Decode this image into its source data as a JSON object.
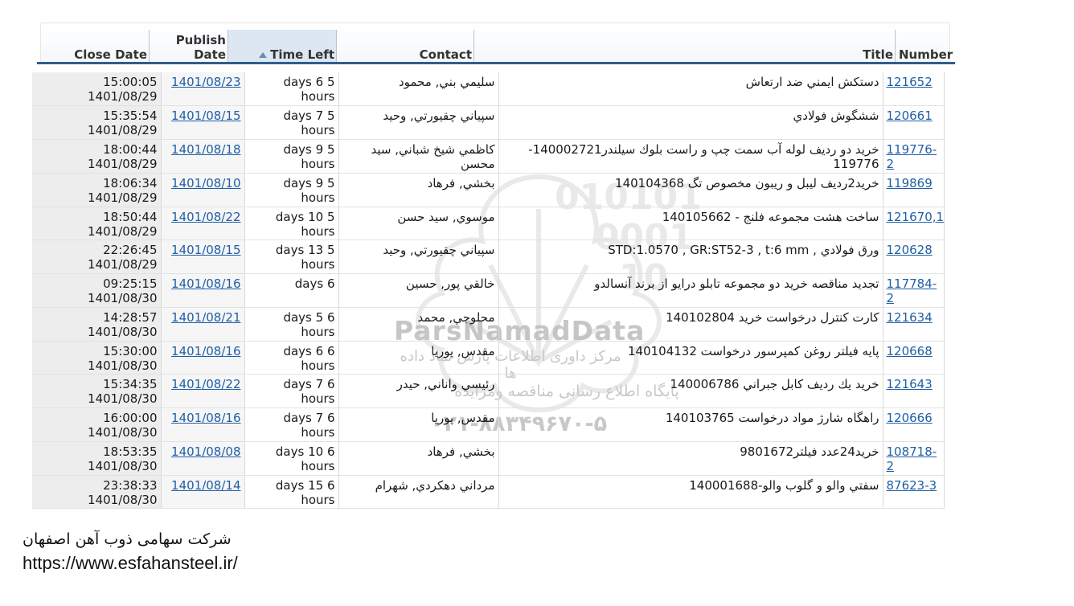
{
  "headers": {
    "close_date": "Close Date",
    "publish_date_line1": "Publish",
    "publish_date_line2": "Date",
    "time_left": "Time Left",
    "contact": "Contact",
    "title": "Title",
    "number": "Number"
  },
  "rows": [
    {
      "close": "15:00:05 1401/08/29",
      "publish": "1401/08/23",
      "time_left": "5 days 6 hours",
      "contact": "سليمي بني, محمود",
      "title": "دستكش ايمني ضد ارتعاش",
      "number": "121652"
    },
    {
      "close": "15:35:54 1401/08/29",
      "publish": "1401/08/15",
      "time_left": "5 days 7 hours",
      "contact": "سپياني چقيورتي, وحيد",
      "title": "ششگوش فولادي",
      "number": "120661"
    },
    {
      "close": "18:00:44 1401/08/29",
      "publish": "1401/08/18",
      "time_left": "5 days 9 hours",
      "contact": "كاظمي شيخ شباني, سيد محسن",
      "title": "خريد دو رديف لوله آب سمت چپ و راست بلوك سيلندر140002721-119776",
      "number": "119776-2"
    },
    {
      "close": "18:06:34 1401/08/29",
      "publish": "1401/08/10",
      "time_left": "5 days 9 hours",
      "contact": "بخشي, فرهاد",
      "title": "خريد2رديف ليبل و ريبون مخصوص تگ 140104368",
      "number": "119869"
    },
    {
      "close": "18:50:44 1401/08/29",
      "publish": "1401/08/22",
      "time_left": "5 days 10 hours",
      "contact": "موسوي, سيد حسن",
      "title": "ساخت هشت مجموعه فلنج - 140105662",
      "number": "121670,1"
    },
    {
      "close": "22:26:45 1401/08/29",
      "publish": "1401/08/15",
      "time_left": "5 days 13 hours",
      "contact": "سپياني چقيورتي, وحيد",
      "title": "ورق فولادي , STD:1.0570 , GR:ST52-3 , t:6 mm",
      "number": "120628"
    },
    {
      "close": "09:25:15 1401/08/30",
      "publish": "1401/08/16",
      "time_left": "6 days",
      "contact": "خالقي پور, حسين",
      "title": "تجديد مناقصه خريد دو مجموعه تابلو درايو از برند آنسالدو",
      "number": "117784-2"
    },
    {
      "close": "14:28:57 1401/08/30",
      "publish": "1401/08/21",
      "time_left": "6 days 5 hours",
      "contact": "محلوجي, محمد",
      "title": "كارت كنترل درخواست خريد 140102804",
      "number": "121634"
    },
    {
      "close": "15:30:00 1401/08/30",
      "publish": "1401/08/16",
      "time_left": "6 days 6 hours",
      "contact": "مقدس, پوريا",
      "title": "پايه فيلتر روغن كمپرسور درخواست 140104132",
      "number": "120668"
    },
    {
      "close": "15:34:35 1401/08/30",
      "publish": "1401/08/22",
      "time_left": "6 days 7 hours",
      "contact": "رئيسي واناني, حيدر",
      "title": "خريد يك رديف كابل جبراني 140006786",
      "number": "121643"
    },
    {
      "close": "16:00:00 1401/08/30",
      "publish": "1401/08/16",
      "time_left": "6 days 7 hours",
      "contact": "مقدس, پوريا",
      "title": "راهگاه شارژ مواد درخواست 140103765",
      "number": "120666"
    },
    {
      "close": "18:53:35 1401/08/30",
      "publish": "1401/08/08",
      "time_left": "6 days 10 hours",
      "contact": "بخشي, فرهاد",
      "title": "خريد24عدد فيلتر9801672",
      "number": "108718-2"
    },
    {
      "close": "23:38:33 1401/08/30",
      "publish": "1401/08/14",
      "time_left": "6 days 15 hours",
      "contact": "مرداني دهكردي, شهرام",
      "title": "سفتي والو و گلوب والو-140001688",
      "number": "87623-3"
    }
  ],
  "watermark": {
    "brand": "ParsNamadData",
    "line1": "مرکز داوری اطلاعات پارس نماد داده ها",
    "line2": "پایگاه اطلاع رسانی مناقصه ومزایده",
    "phone": "۰۲۱-۸۸۳۴۹۶۷۰-۵"
  },
  "footer": {
    "company": "شرکت سهامی ذوب آهن اصفهان",
    "url": "https://www.esfahansteel.ir/"
  },
  "colors": {
    "header_rule": "#2f5d8c",
    "link": "#1f5fa6"
  }
}
